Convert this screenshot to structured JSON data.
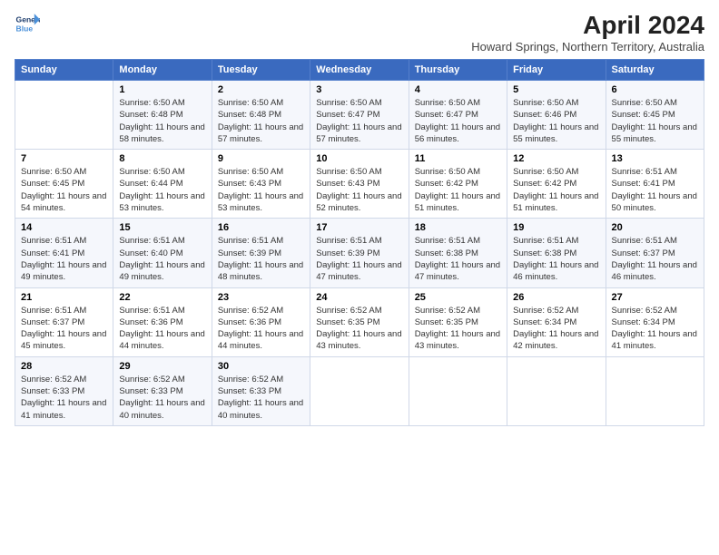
{
  "logo": {
    "line1": "General",
    "line2": "Blue"
  },
  "title": "April 2024",
  "subtitle": "Howard Springs, Northern Territory, Australia",
  "days_of_week": [
    "Sunday",
    "Monday",
    "Tuesday",
    "Wednesday",
    "Thursday",
    "Friday",
    "Saturday"
  ],
  "weeks": [
    [
      {
        "num": "",
        "sunrise": "",
        "sunset": "",
        "daylight": ""
      },
      {
        "num": "1",
        "sunrise": "Sunrise: 6:50 AM",
        "sunset": "Sunset: 6:48 PM",
        "daylight": "Daylight: 11 hours and 58 minutes."
      },
      {
        "num": "2",
        "sunrise": "Sunrise: 6:50 AM",
        "sunset": "Sunset: 6:48 PM",
        "daylight": "Daylight: 11 hours and 57 minutes."
      },
      {
        "num": "3",
        "sunrise": "Sunrise: 6:50 AM",
        "sunset": "Sunset: 6:47 PM",
        "daylight": "Daylight: 11 hours and 57 minutes."
      },
      {
        "num": "4",
        "sunrise": "Sunrise: 6:50 AM",
        "sunset": "Sunset: 6:47 PM",
        "daylight": "Daylight: 11 hours and 56 minutes."
      },
      {
        "num": "5",
        "sunrise": "Sunrise: 6:50 AM",
        "sunset": "Sunset: 6:46 PM",
        "daylight": "Daylight: 11 hours and 55 minutes."
      },
      {
        "num": "6",
        "sunrise": "Sunrise: 6:50 AM",
        "sunset": "Sunset: 6:45 PM",
        "daylight": "Daylight: 11 hours and 55 minutes."
      }
    ],
    [
      {
        "num": "7",
        "sunrise": "Sunrise: 6:50 AM",
        "sunset": "Sunset: 6:45 PM",
        "daylight": "Daylight: 11 hours and 54 minutes."
      },
      {
        "num": "8",
        "sunrise": "Sunrise: 6:50 AM",
        "sunset": "Sunset: 6:44 PM",
        "daylight": "Daylight: 11 hours and 53 minutes."
      },
      {
        "num": "9",
        "sunrise": "Sunrise: 6:50 AM",
        "sunset": "Sunset: 6:43 PM",
        "daylight": "Daylight: 11 hours and 53 minutes."
      },
      {
        "num": "10",
        "sunrise": "Sunrise: 6:50 AM",
        "sunset": "Sunset: 6:43 PM",
        "daylight": "Daylight: 11 hours and 52 minutes."
      },
      {
        "num": "11",
        "sunrise": "Sunrise: 6:50 AM",
        "sunset": "Sunset: 6:42 PM",
        "daylight": "Daylight: 11 hours and 51 minutes."
      },
      {
        "num": "12",
        "sunrise": "Sunrise: 6:50 AM",
        "sunset": "Sunset: 6:42 PM",
        "daylight": "Daylight: 11 hours and 51 minutes."
      },
      {
        "num": "13",
        "sunrise": "Sunrise: 6:51 AM",
        "sunset": "Sunset: 6:41 PM",
        "daylight": "Daylight: 11 hours and 50 minutes."
      }
    ],
    [
      {
        "num": "14",
        "sunrise": "Sunrise: 6:51 AM",
        "sunset": "Sunset: 6:41 PM",
        "daylight": "Daylight: 11 hours and 49 minutes."
      },
      {
        "num": "15",
        "sunrise": "Sunrise: 6:51 AM",
        "sunset": "Sunset: 6:40 PM",
        "daylight": "Daylight: 11 hours and 49 minutes."
      },
      {
        "num": "16",
        "sunrise": "Sunrise: 6:51 AM",
        "sunset": "Sunset: 6:39 PM",
        "daylight": "Daylight: 11 hours and 48 minutes."
      },
      {
        "num": "17",
        "sunrise": "Sunrise: 6:51 AM",
        "sunset": "Sunset: 6:39 PM",
        "daylight": "Daylight: 11 hours and 47 minutes."
      },
      {
        "num": "18",
        "sunrise": "Sunrise: 6:51 AM",
        "sunset": "Sunset: 6:38 PM",
        "daylight": "Daylight: 11 hours and 47 minutes."
      },
      {
        "num": "19",
        "sunrise": "Sunrise: 6:51 AM",
        "sunset": "Sunset: 6:38 PM",
        "daylight": "Daylight: 11 hours and 46 minutes."
      },
      {
        "num": "20",
        "sunrise": "Sunrise: 6:51 AM",
        "sunset": "Sunset: 6:37 PM",
        "daylight": "Daylight: 11 hours and 46 minutes."
      }
    ],
    [
      {
        "num": "21",
        "sunrise": "Sunrise: 6:51 AM",
        "sunset": "Sunset: 6:37 PM",
        "daylight": "Daylight: 11 hours and 45 minutes."
      },
      {
        "num": "22",
        "sunrise": "Sunrise: 6:51 AM",
        "sunset": "Sunset: 6:36 PM",
        "daylight": "Daylight: 11 hours and 44 minutes."
      },
      {
        "num": "23",
        "sunrise": "Sunrise: 6:52 AM",
        "sunset": "Sunset: 6:36 PM",
        "daylight": "Daylight: 11 hours and 44 minutes."
      },
      {
        "num": "24",
        "sunrise": "Sunrise: 6:52 AM",
        "sunset": "Sunset: 6:35 PM",
        "daylight": "Daylight: 11 hours and 43 minutes."
      },
      {
        "num": "25",
        "sunrise": "Sunrise: 6:52 AM",
        "sunset": "Sunset: 6:35 PM",
        "daylight": "Daylight: 11 hours and 43 minutes."
      },
      {
        "num": "26",
        "sunrise": "Sunrise: 6:52 AM",
        "sunset": "Sunset: 6:34 PM",
        "daylight": "Daylight: 11 hours and 42 minutes."
      },
      {
        "num": "27",
        "sunrise": "Sunrise: 6:52 AM",
        "sunset": "Sunset: 6:34 PM",
        "daylight": "Daylight: 11 hours and 41 minutes."
      }
    ],
    [
      {
        "num": "28",
        "sunrise": "Sunrise: 6:52 AM",
        "sunset": "Sunset: 6:33 PM",
        "daylight": "Daylight: 11 hours and 41 minutes."
      },
      {
        "num": "29",
        "sunrise": "Sunrise: 6:52 AM",
        "sunset": "Sunset: 6:33 PM",
        "daylight": "Daylight: 11 hours and 40 minutes."
      },
      {
        "num": "30",
        "sunrise": "Sunrise: 6:52 AM",
        "sunset": "Sunset: 6:33 PM",
        "daylight": "Daylight: 11 hours and 40 minutes."
      },
      {
        "num": "",
        "sunrise": "",
        "sunset": "",
        "daylight": ""
      },
      {
        "num": "",
        "sunrise": "",
        "sunset": "",
        "daylight": ""
      },
      {
        "num": "",
        "sunrise": "",
        "sunset": "",
        "daylight": ""
      },
      {
        "num": "",
        "sunrise": "",
        "sunset": "",
        "daylight": ""
      }
    ]
  ]
}
